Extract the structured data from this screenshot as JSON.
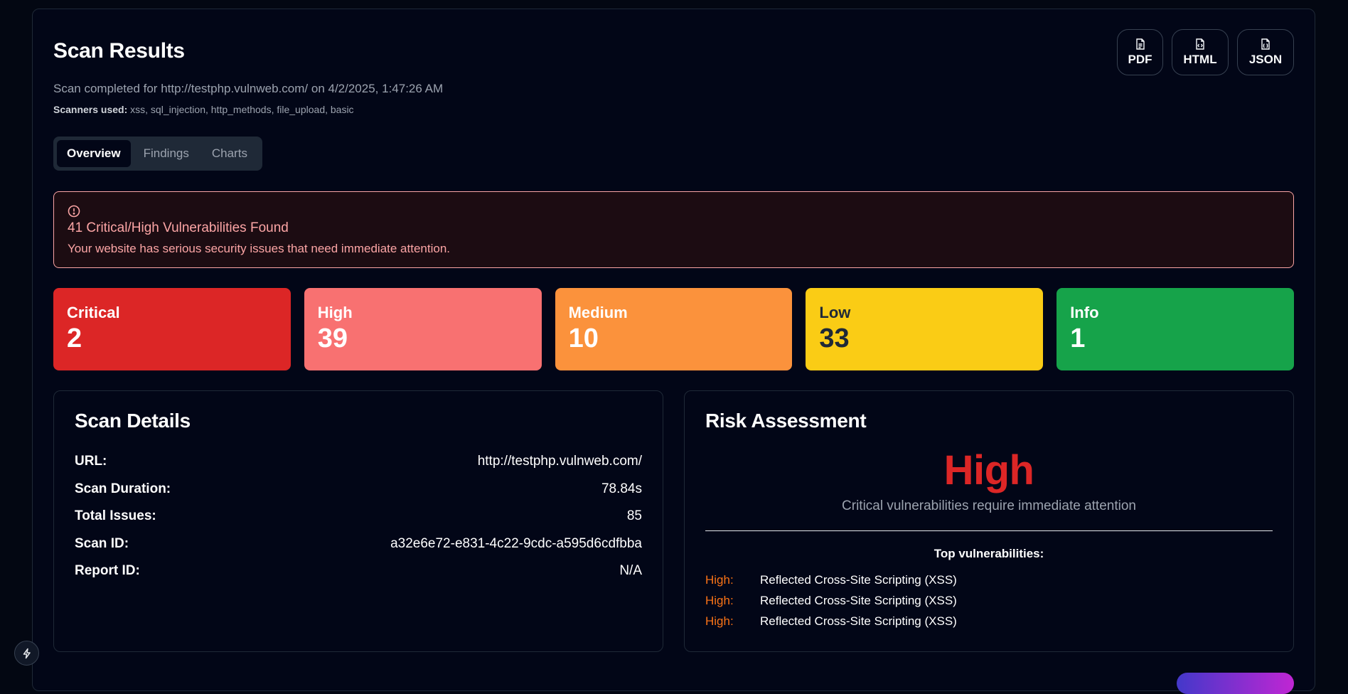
{
  "header": {
    "title": "Scan Results",
    "subtitle": "Scan completed for http://testphp.vulnweb.com/ on 4/2/2025, 1:47:26 AM",
    "scanners_label": "Scanners used:",
    "scanners_value": "xss, sql_injection, http_methods, file_upload, basic"
  },
  "exports": [
    {
      "label": "PDF",
      "icon": "file-text-icon"
    },
    {
      "label": "HTML",
      "icon": "file-code-icon"
    },
    {
      "label": "JSON",
      "icon": "file-json-icon"
    }
  ],
  "tabs": [
    {
      "label": "Overview",
      "active": true
    },
    {
      "label": "Findings",
      "active": false
    },
    {
      "label": "Charts",
      "active": false
    }
  ],
  "alert": {
    "icon": "alert-circle-icon",
    "title": "41 Critical/High Vulnerabilities Found",
    "description": "Your website has serious security issues that need immediate attention."
  },
  "severity": [
    {
      "label": "Critical",
      "count": "2",
      "color": "#dc2626"
    },
    {
      "label": "High",
      "count": "39",
      "color": "#f87171"
    },
    {
      "label": "Medium",
      "count": "10",
      "color": "#fb923c"
    },
    {
      "label": "Low",
      "count": "33",
      "color": "#facc15"
    },
    {
      "label": "Info",
      "count": "1",
      "color": "#16a34a"
    }
  ],
  "scan_details": {
    "title": "Scan Details",
    "rows": [
      {
        "key": "URL:",
        "value": "http://testphp.vulnweb.com/"
      },
      {
        "key": "Scan Duration:",
        "value": "78.84s"
      },
      {
        "key": "Total Issues:",
        "value": "85"
      },
      {
        "key": "Scan ID:",
        "value": "a32e6e72-e831-4c22-9cdc-a595d6cdfbba"
      },
      {
        "key": "Report ID:",
        "value": "N/A"
      }
    ]
  },
  "risk": {
    "title": "Risk Assessment",
    "level": "High",
    "description": "Critical vulnerabilities require immediate attention",
    "top_title": "Top vulnerabilities:",
    "top": [
      {
        "severity": "High:",
        "name": "Reflected Cross-Site Scripting (XSS)"
      },
      {
        "severity": "High:",
        "name": "Reflected Cross-Site Scripting (XSS)"
      },
      {
        "severity": "High:",
        "name": "Reflected Cross-Site Scripting (XSS)"
      }
    ]
  },
  "floating": {
    "icon": "lightning-icon"
  }
}
